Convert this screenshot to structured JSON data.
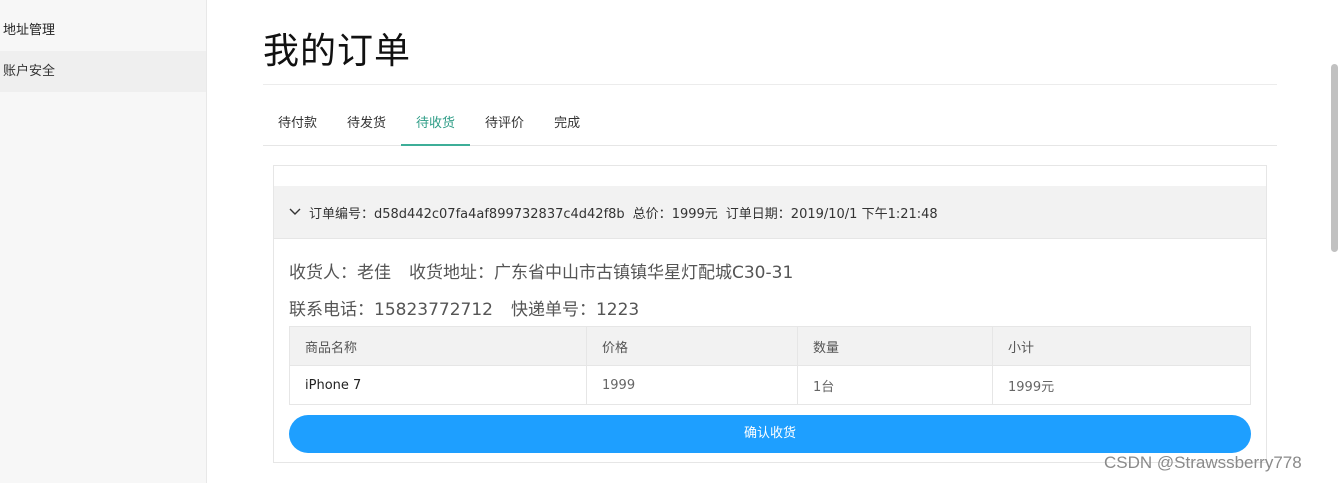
{
  "sidebar": {
    "items": [
      {
        "label": "地址管理"
      },
      {
        "label": "账户安全"
      }
    ]
  },
  "main": {
    "title": "我的订单",
    "tabs": [
      {
        "label": "待付款"
      },
      {
        "label": "待发货"
      },
      {
        "label": "待收货"
      },
      {
        "label": "待评价"
      },
      {
        "label": "完成"
      }
    ],
    "active_tab": "待收货"
  },
  "order": {
    "number_label": "订单编号：",
    "number": "d58d442c07fa4af899732837c4d42f8b",
    "total_label": "总价：",
    "total": "1999元",
    "date_label": "订单日期：",
    "date": "2019/10/1 下午1:21:48",
    "receiver_label": "收货人：",
    "receiver": "老佳",
    "address_label": "收货地址：",
    "address": "广东省中山市古镇镇华星灯配城C30-31",
    "phone_label": "联系电话：",
    "phone": "15823772712",
    "tracking_label": "快递单号：",
    "tracking": "1223",
    "table": {
      "headers": [
        "商品名称",
        "价格",
        "数量",
        "小计"
      ],
      "rows": [
        [
          "iPhone 7",
          "1999",
          "1台",
          "1999元"
        ]
      ]
    },
    "confirm_label": "确认收货"
  },
  "watermark": "CSDN @Strawssberry778",
  "colors": {
    "accent_tab": "#2f9d87",
    "button": "#1e9fff"
  },
  "icons": {
    "order_toggle": "chevron-down-icon"
  }
}
